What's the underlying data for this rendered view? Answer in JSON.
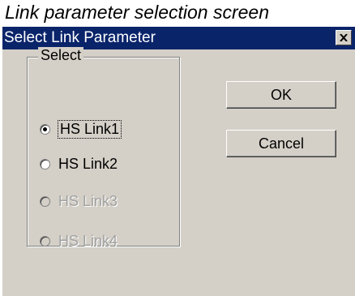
{
  "caption": "Link parameter selection screen",
  "window": {
    "title": "Select Link Parameter",
    "close_icon": "close-x-icon",
    "titlebar_color": "#0a246a"
  },
  "group": {
    "label": "Select",
    "options": [
      {
        "label": "HS Link1",
        "checked": true,
        "enabled": true
      },
      {
        "label": "HS Link2",
        "checked": false,
        "enabled": true
      },
      {
        "label": "HS Link3",
        "checked": false,
        "enabled": false
      },
      {
        "label": "HS Link4",
        "checked": false,
        "enabled": false
      }
    ]
  },
  "buttons": {
    "ok": "OK",
    "cancel": "Cancel"
  }
}
